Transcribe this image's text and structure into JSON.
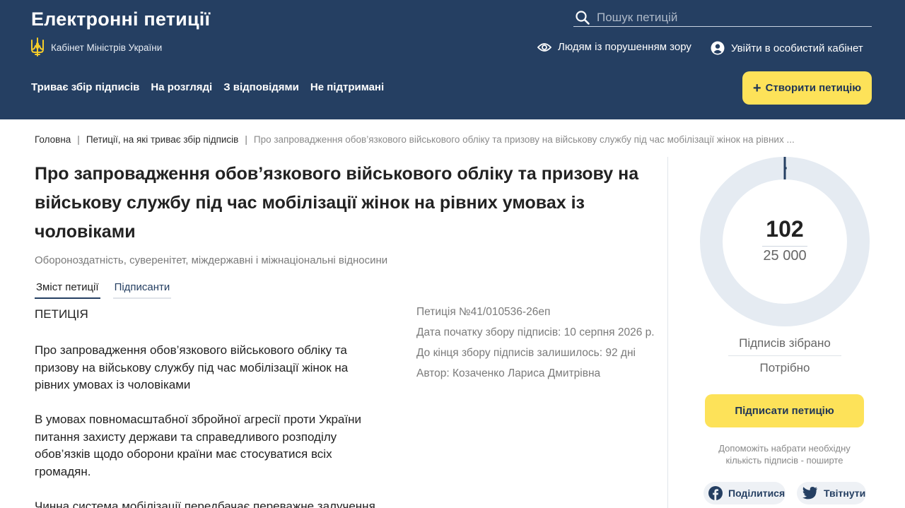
{
  "header": {
    "site_title": "Електронні петиції",
    "gov_label": "Кабінет Міністрів України",
    "search_placeholder": "Пошук петицій",
    "vision_label": "Людям із порушенням зору",
    "login_label": "Увійти в особистий кабінет",
    "nav": [
      "Триває збір підписів",
      "На розгляді",
      "З відповідями",
      "Не підтримані"
    ],
    "create_label": "Створити петицію"
  },
  "breadcrumb": {
    "home": "Головна",
    "section": "Петиції, на які триває збір підписів",
    "current": "Про запровадження обов’язкового військового обліку та призову на військову службу під час мобілізації жінок на рівних ..."
  },
  "petition": {
    "title": "Про запровадження обов’язкового військового обліку та призову на військову службу під час мобілізації жінок на рівних умовах із чоловіками",
    "category": "Обороноздатність, суверенітет, міждержавні і міжнаціональні відносини",
    "tabs": [
      "Зміст петиції",
      "Підписанти"
    ],
    "heading": "ПЕТИЦІЯ",
    "paragraphs": [
      "Про запровадження обов’язкового військового обліку та призову на військову службу під час мобілізації жінок на рівних умовах із чоловіками",
      "В умовах повномасштабної збройної агресії проти України питання захисту держави та справедливого розподілу обов’язків щодо оборони країни має стосуватися всіх громадян.",
      "Чинна система мобілізації передбачає переважне залучення"
    ],
    "meta": {
      "number": "Петиція №41/010536-26еп",
      "start_date": "Дата початку збору підписів: 10 серпня 2026 р.",
      "days_left": "До кінця збору підписів залишилось: 92 дні",
      "author": "Автор: Козаченко Лариса Дмитрівна"
    }
  },
  "signatures": {
    "collected": "102",
    "required": "25 000",
    "progress_fraction": 0.00408,
    "collected_label": "Підписів зібрано",
    "required_label": "Потрібно",
    "sign_label": "Підписати петицію",
    "help_text": "Допоможіть набрати необхідну кількість підписів - поширте",
    "share_facebook": "Поділитися",
    "share_twitter": "Твітнути"
  },
  "colors": {
    "header_bg": "#253f62",
    "accent_yellow": "#fde259",
    "ring_track": "#e5ebf2",
    "ring_progress": "#253f62"
  },
  "icons": [
    "search-icon",
    "tryzub-emblem-icon",
    "eye-icon",
    "user-icon",
    "plus-icon",
    "facebook-icon",
    "twitter-icon"
  ]
}
